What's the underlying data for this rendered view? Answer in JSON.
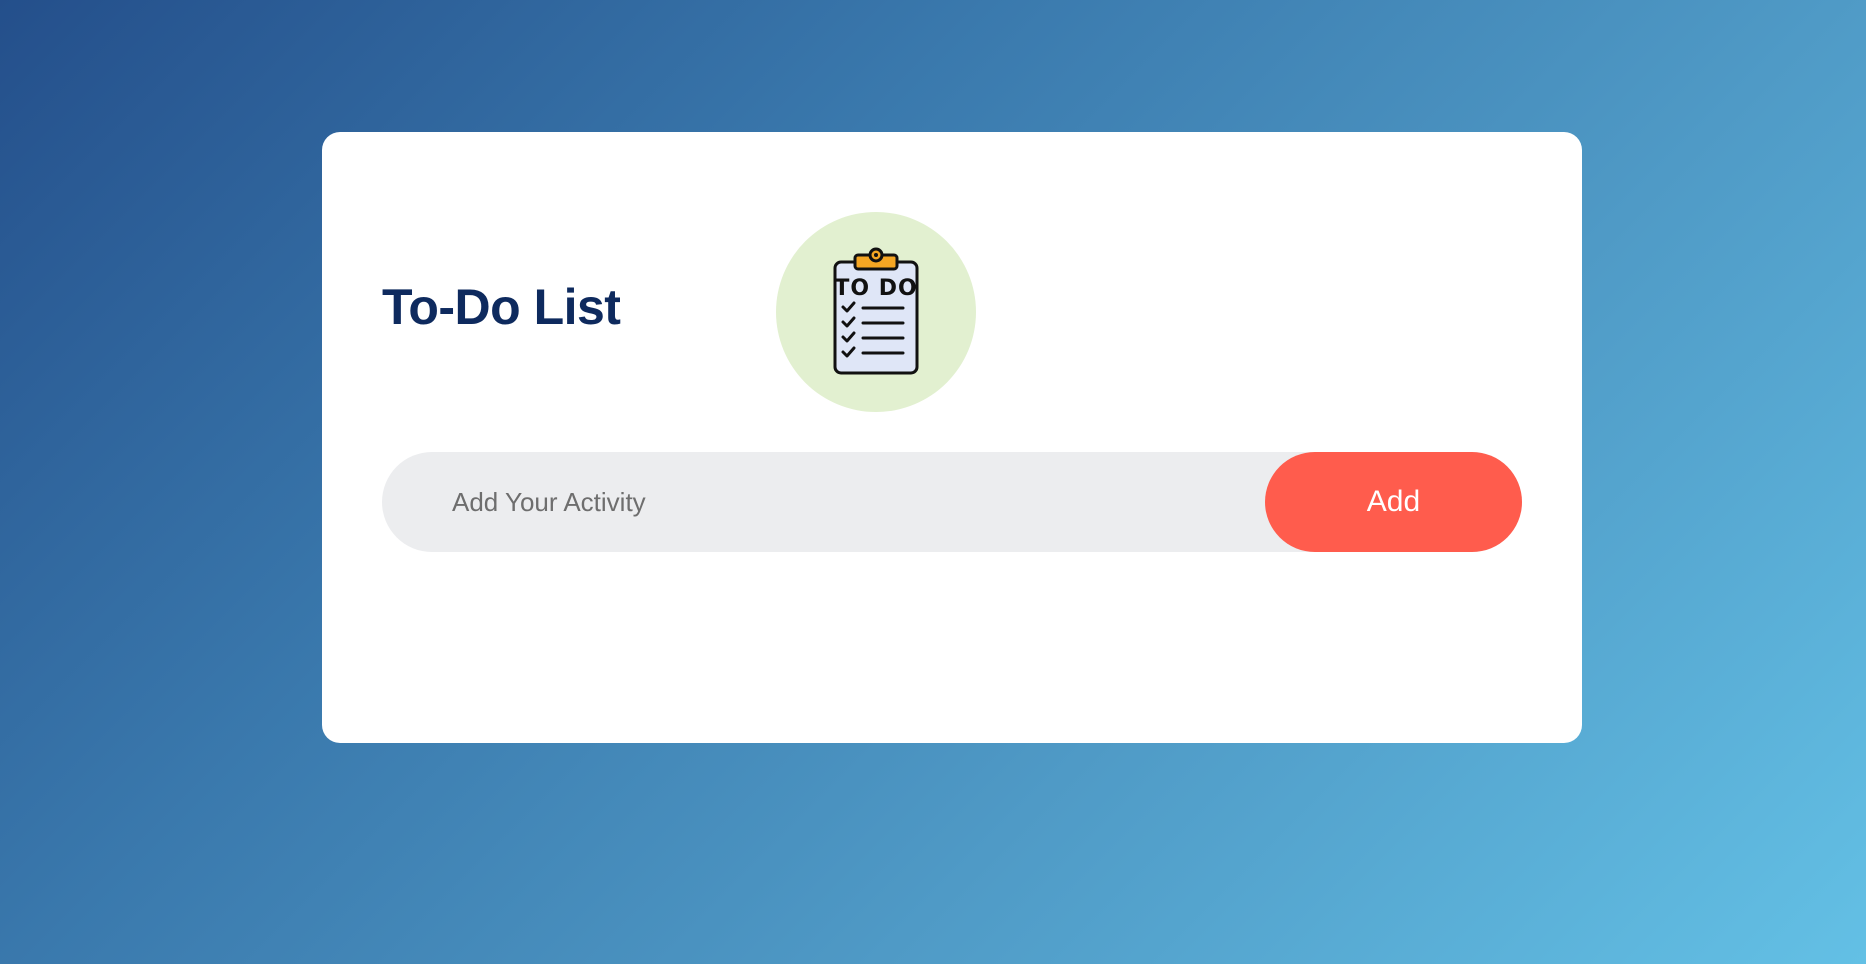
{
  "app": {
    "title": "To-Do List",
    "logo": {
      "icon": "clipboard-todo-icon",
      "text": "TO DO",
      "circle_color": "#e2f0d0",
      "clip_color": "#f5a623"
    }
  },
  "form": {
    "input_placeholder": "Add Your Activity",
    "input_value": "",
    "add_label": "Add",
    "add_color": "#ff5c4d"
  },
  "tasks": []
}
